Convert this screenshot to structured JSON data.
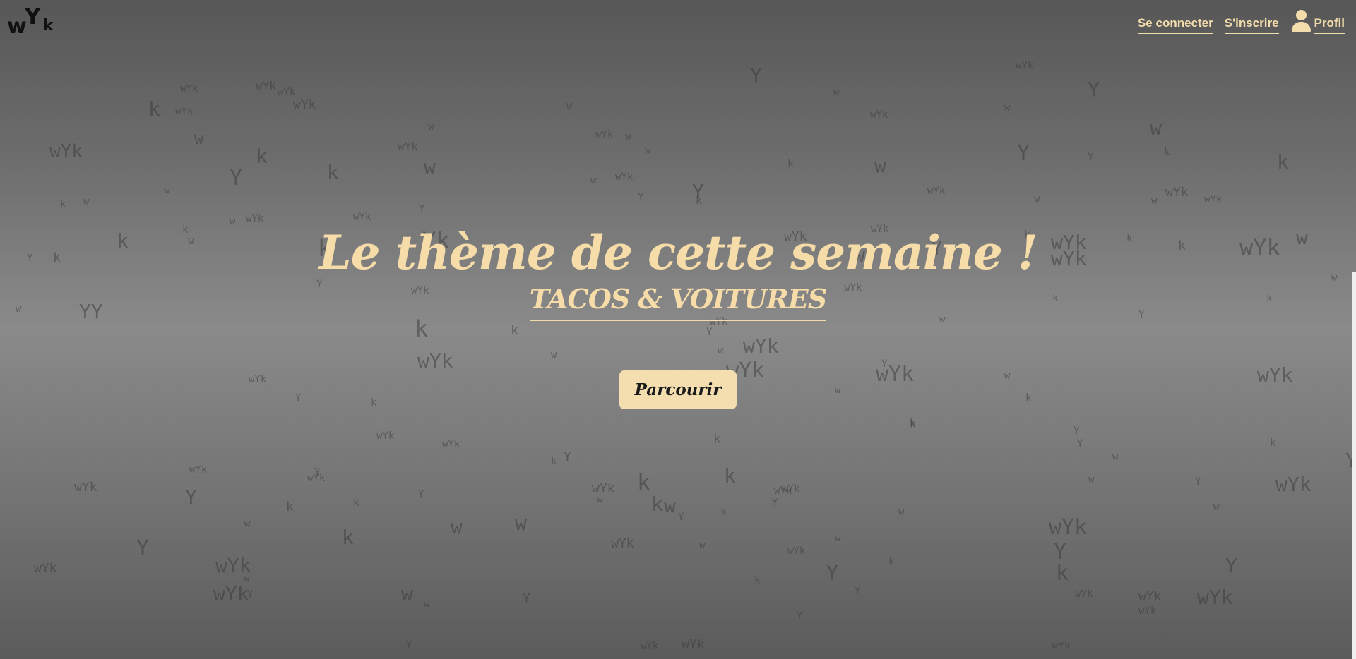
{
  "logo": {
    "w": "w",
    "Y": "Y",
    "k": "k"
  },
  "nav": {
    "login": "Se connecter",
    "signup": "S'inscrire",
    "profile": "Profil"
  },
  "hero": {
    "title": "Le thème de cette semaine !",
    "theme": "TACOS & VOITURES",
    "browse_label": "Parcourir"
  },
  "colors": {
    "accent": "#f6dca8",
    "button_bg": "#f4deb0"
  },
  "background_letters": [
    [
      "wYk",
      70,
      200,
      26
    ],
    [
      "k",
      210,
      138,
      28
    ],
    [
      "wYk",
      248,
      150,
      14
    ],
    [
      "wYk",
      255,
      118,
      14
    ],
    [
      "wYk",
      362,
      112,
      16
    ],
    [
      "wYk",
      393,
      123,
      14
    ],
    [
      "wYk",
      415,
      138,
      18
    ],
    [
      "w",
      275,
      185,
      22
    ],
    [
      "k",
      362,
      205,
      28
    ],
    [
      "Y",
      325,
      235,
      30
    ],
    [
      "k",
      463,
      228,
      28
    ],
    [
      "w",
      232,
      262,
      14
    ],
    [
      "k",
      85,
      282,
      14
    ],
    [
      "w",
      118,
      278,
      14
    ],
    [
      "k",
      165,
      325,
      28
    ],
    [
      "k",
      258,
      318,
      14
    ],
    [
      "w",
      266,
      334,
      14
    ],
    [
      "w",
      325,
      306,
      14
    ],
    [
      "wYk",
      348,
      302,
      14
    ],
    [
      "k",
      450,
      333,
      32
    ],
    [
      "Y",
      38,
      358,
      14
    ],
    [
      "k",
      75,
      355,
      18
    ],
    [
      "Y",
      448,
      395,
      14
    ],
    [
      "w",
      22,
      430,
      14
    ],
    [
      "YY",
      112,
      425,
      28
    ],
    [
      "wYk",
      352,
      530,
      14
    ],
    [
      "Y",
      418,
      556,
      14
    ],
    [
      "k",
      525,
      563,
      14
    ],
    [
      "wYk",
      500,
      300,
      14
    ],
    [
      "Yk",
      598,
      322,
      32
    ],
    [
      "wYk",
      582,
      404,
      14
    ],
    [
      "wYk",
      563,
      198,
      16
    ],
    [
      "w",
      600,
      220,
      28
    ],
    [
      "w",
      606,
      172,
      14
    ],
    [
      "Y",
      593,
      288,
      14
    ],
    [
      "k",
      587,
      447,
      32
    ],
    [
      "wYk",
      591,
      495,
      28
    ],
    [
      "wYk",
      533,
      610,
      14
    ],
    [
      "wYk",
      626,
      622,
      14
    ],
    [
      "w",
      780,
      495,
      14
    ],
    [
      "k",
      723,
      458,
      18
    ],
    [
      "w",
      802,
      142,
      14
    ],
    [
      "wYk",
      843,
      183,
      14
    ],
    [
      "w",
      885,
      186,
      14
    ],
    [
      "w",
      913,
      205,
      14
    ],
    [
      "w",
      836,
      248,
      14
    ],
    [
      "wYk",
      871,
      243,
      14
    ],
    [
      "Y",
      903,
      272,
      14
    ],
    [
      "Y",
      980,
      255,
      28
    ],
    [
      "k",
      985,
      277,
      14
    ],
    [
      "wYk",
      1052,
      474,
      28
    ],
    [
      "wYk",
      1028,
      508,
      30
    ],
    [
      "w",
      1016,
      489,
      14
    ],
    [
      "Y",
      1000,
      463,
      14
    ],
    [
      "wYk",
      1005,
      448,
      14
    ],
    [
      "Y",
      1062,
      90,
      28
    ],
    [
      "wYk",
      1110,
      325,
      18
    ],
    [
      "w",
      1208,
      345,
      28
    ],
    [
      "wYk",
      1233,
      317,
      14
    ],
    [
      "wYk",
      1195,
      400,
      14
    ],
    [
      "k",
      1115,
      224,
      14
    ],
    [
      "w",
      1238,
      218,
      28
    ],
    [
      "wYk",
      1232,
      155,
      14
    ],
    [
      "w",
      1180,
      123,
      14
    ],
    [
      "Y",
      1318,
      335,
      28
    ],
    [
      "wYk",
      1313,
      263,
      14
    ],
    [
      "wYk",
      1240,
      513,
      30
    ],
    [
      "Y",
      1248,
      508,
      14
    ],
    [
      "w",
      1330,
      445,
      14
    ],
    [
      "w",
      1182,
      545,
      14
    ],
    [
      "k",
      1288,
      594,
      14
    ],
    [
      "k",
      1010,
      612,
      18
    ],
    [
      "wYk",
      1096,
      688,
      14
    ],
    [
      "k",
      1450,
      325,
      14
    ],
    [
      "wYk",
      1488,
      327,
      28
    ],
    [
      "Y",
      1440,
      200,
      30
    ],
    [
      "Y",
      1540,
      110,
      28
    ],
    [
      "wYk",
      1438,
      85,
      14
    ],
    [
      "w",
      1422,
      145,
      14
    ],
    [
      "Y",
      1540,
      215,
      14
    ],
    [
      "w",
      1464,
      274,
      14
    ],
    [
      "wYk",
      1650,
      262,
      18
    ],
    [
      "wYk",
      1705,
      275,
      14
    ],
    [
      "w",
      1628,
      165,
      28
    ],
    [
      "k",
      1648,
      208,
      14
    ],
    [
      "k",
      1808,
      213,
      28
    ],
    [
      "w",
      1630,
      277,
      14
    ],
    [
      "wYk",
      1488,
      350,
      28
    ],
    [
      "k",
      1595,
      330,
      14
    ],
    [
      "k",
      1668,
      338,
      18
    ],
    [
      "w",
      1835,
      320,
      28
    ],
    [
      "wYk",
      1755,
      332,
      32
    ],
    [
      "w",
      1885,
      386,
      14
    ],
    [
      "k",
      1490,
      415,
      14
    ],
    [
      "Y",
      1612,
      438,
      14
    ],
    [
      "k",
      1793,
      415,
      14
    ],
    [
      "wYk",
      1780,
      515,
      28
    ],
    [
      "w",
      1422,
      525,
      14
    ],
    [
      "k",
      1452,
      556,
      14
    ],
    [
      "k",
      1288,
      592,
      14
    ],
    [
      "Y",
      1520,
      603,
      14
    ],
    [
      "Y",
      1525,
      621,
      14
    ],
    [
      "w",
      1575,
      640,
      14
    ],
    [
      "w",
      1541,
      672,
      14
    ],
    [
      "Y",
      1692,
      675,
      14
    ],
    [
      "w",
      1718,
      711,
      14
    ],
    [
      "wYk",
      1806,
      670,
      28
    ],
    [
      "k",
      1798,
      620,
      14
    ],
    [
      "Y",
      1905,
      636,
      28
    ],
    [
      "wYk",
      1485,
      730,
      30
    ],
    [
      "Y",
      1492,
      765,
      30
    ],
    [
      "k",
      1495,
      795,
      30
    ],
    [
      "Y",
      1735,
      785,
      28
    ],
    [
      "wYk",
      1522,
      834,
      14
    ],
    [
      "wYk",
      1612,
      835,
      18
    ],
    [
      "wYk",
      1612,
      858,
      14
    ],
    [
      "wYk",
      1695,
      830,
      28
    ],
    [
      "wYk",
      1490,
      908,
      14
    ],
    [
      "k",
      1020,
      718,
      14
    ],
    [
      "wYk",
      1107,
      685,
      14
    ],
    [
      "Y",
      1093,
      705,
      14
    ],
    [
      "k",
      902,
      665,
      32
    ],
    [
      "k",
      1025,
      658,
      28
    ],
    [
      "w",
      845,
      700,
      14
    ],
    [
      "k",
      780,
      646,
      14
    ],
    [
      "Y",
      798,
      637,
      18
    ],
    [
      "wYk",
      838,
      682,
      18
    ],
    [
      "k",
      922,
      698,
      28
    ],
    [
      "w",
      940,
      700,
      28
    ],
    [
      "Y",
      960,
      725,
      14
    ],
    [
      "wYk",
      865,
      760,
      18
    ],
    [
      "w",
      990,
      765,
      14
    ],
    [
      "k",
      1068,
      815,
      14
    ],
    [
      "wYk",
      1115,
      773,
      14
    ],
    [
      "Y",
      1170,
      795,
      28
    ],
    [
      "w",
      1182,
      755,
      14
    ],
    [
      "k",
      1258,
      788,
      14
    ],
    [
      "Y",
      1210,
      830,
      14
    ],
    [
      "Y",
      1128,
      865,
      14
    ],
    [
      "w",
      1272,
      718,
      14
    ],
    [
      "wYk",
      965,
      903,
      18
    ],
    [
      "wYk",
      907,
      908,
      14
    ],
    [
      "Y",
      575,
      907,
      14
    ],
    [
      "w",
      729,
      725,
      28
    ],
    [
      "w",
      568,
      825,
      28
    ],
    [
      "w",
      600,
      848,
      14
    ],
    [
      "Y",
      740,
      838,
      18
    ],
    [
      "wYk",
      105,
      680,
      18
    ],
    [
      "wYk",
      268,
      658,
      14
    ],
    [
      "Y",
      262,
      688,
      28
    ],
    [
      "Y",
      445,
      662,
      14
    ],
    [
      "k",
      405,
      708,
      18
    ],
    [
      "k",
      500,
      705,
      14
    ],
    [
      "w",
      346,
      735,
      14
    ],
    [
      "k",
      484,
      745,
      28
    ],
    [
      "Y",
      193,
      760,
      30
    ],
    [
      "wYk",
      305,
      785,
      28
    ],
    [
      "wYk",
      48,
      795,
      18
    ],
    [
      "wYk",
      302,
      825,
      28
    ],
    [
      "w",
      345,
      812,
      14
    ],
    [
      "Y",
      350,
      835,
      14
    ],
    [
      "wYk",
      435,
      670,
      14
    ],
    [
      "Y",
      592,
      693,
      14
    ],
    [
      "w",
      638,
      730,
      28
    ]
  ]
}
